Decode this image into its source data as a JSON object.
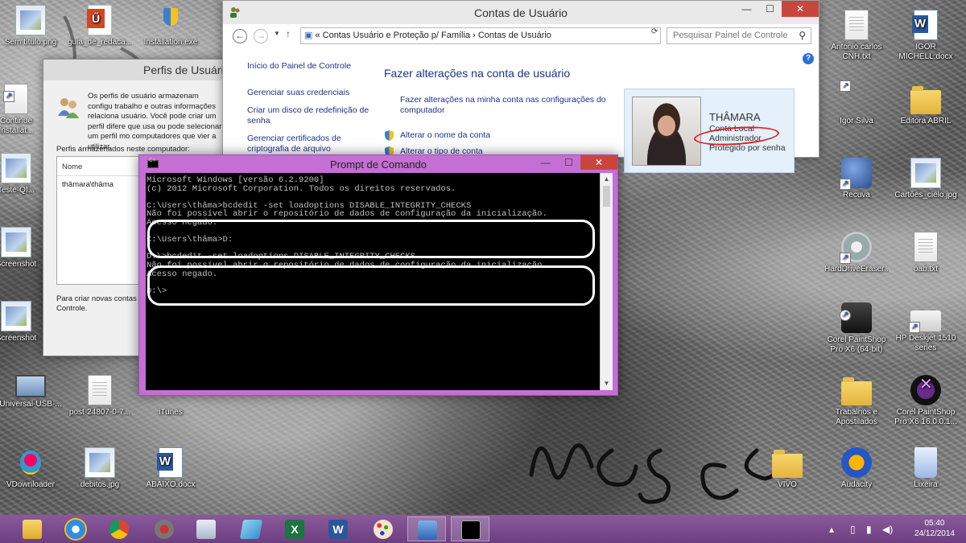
{
  "desktop": {
    "icons": [
      {
        "label": "Sem título.png"
      },
      {
        "label": "guia_de_redaca..."
      },
      {
        "label": "Installation.exe"
      },
      {
        "label": "Continue Installat..."
      },
      {
        "label": "Teste-QI..."
      },
      {
        "label": "Screenshot"
      },
      {
        "label": "Screenshot"
      },
      {
        "label": "Universal-USB-..."
      },
      {
        "label": "post-24807-0-7..."
      },
      {
        "label": "iTunes"
      },
      {
        "label": "VDownloader"
      },
      {
        "label": "debitos.jpg"
      },
      {
        "label": "ABAIXO.docx"
      },
      {
        "label": "Antonio carlos CNH.txt"
      },
      {
        "label": "IGOR MICHELL.docx"
      },
      {
        "label": "Igor Silva"
      },
      {
        "label": "Editora ABRIL"
      },
      {
        "label": "Recuva"
      },
      {
        "label": "Cartões_cielo.jpg"
      },
      {
        "label": "HardDriveEraser..."
      },
      {
        "label": "oab.txt"
      },
      {
        "label": "Corel PaintShop Pro X6 (64-bit)"
      },
      {
        "label": "HP Deskjet 1510 series"
      },
      {
        "label": "Trabalhos e Apostilados"
      },
      {
        "label": "Corel PaintShop Pro X6 16.0.0.1..."
      },
      {
        "label": "VIVO"
      },
      {
        "label": "Audacity"
      },
      {
        "label": "Lixeira"
      }
    ]
  },
  "accounts_window": {
    "title": "Contas de Usuário",
    "address": "« Contas Usuário e Proteção p/ Família  ›  Contas de Usuário",
    "search_placeholder": "Pesquisar Painel de Controle",
    "left_links": [
      "Início do Painel de Controle",
      "Gerenciar suas credenciais",
      "Criar um disco de redefinição de senha",
      "Gerenciar certificados de criptografia de arquivo"
    ],
    "heading": "Fazer alterações na conta de usuário",
    "links": [
      "Fazer alterações na minha conta nas configurações do computador",
      "Alterar o nome da conta",
      "Alterar o tipo de conta"
    ],
    "user": {
      "name": "THÂMARA",
      "line1": "Conta Local",
      "line2": "Administrador",
      "line3": "Protegido por senha"
    }
  },
  "profiles_window": {
    "title": "Perfis de Usuário",
    "description": "Os perfis de usuário armazenam configu trabalho e outras informações relaciona usuário. Você pode criar um perfil difere que usa ou pode selecionar um perfil mo computadores que vier a utilizar.",
    "stored_label": "Perfis armazenados neste computador:",
    "column_name": "Nome",
    "row": "thâmara\\thâma",
    "footer": "Para criar novas contas de Controle."
  },
  "cmd_window": {
    "title": "Prompt de Comando",
    "lines": [
      "Microsoft Windows [versão 6.2.9200]",
      "(c) 2012 Microsoft Corporation. Todos os direitos reservados.",
      "",
      "C:\\Users\\thâma>bcdedit -set loadoptions DISABLE_INTEGRITY_CHECKS",
      "Não foi possível abrir o repositório de dados de configuração da inicialização.",
      "Acesso negado.",
      "",
      "C:\\Users\\thâma>D:",
      "",
      "D:\\>bcdedit -set loadoptions DISABLE_INTEGRITY_CHECKS",
      "Não foi possível abrir o repositório de dados de configuração da inicialização.",
      "Acesso negado.",
      "",
      "D:\\>"
    ]
  },
  "taskbar": {
    "apps": [
      "file-explorer",
      "internet-explorer",
      "chrome",
      "media",
      "calculator",
      "notes",
      "excel",
      "word",
      "paint",
      "control-panel",
      "command-prompt"
    ],
    "time": "05:40",
    "date": "24/12/2014"
  },
  "colors": {
    "cmd_frame": "#c46fd3",
    "taskbar": "#7a4b8a",
    "link": "#1e3287",
    "close": "#c9463d",
    "annotation_red": "#e02020"
  }
}
